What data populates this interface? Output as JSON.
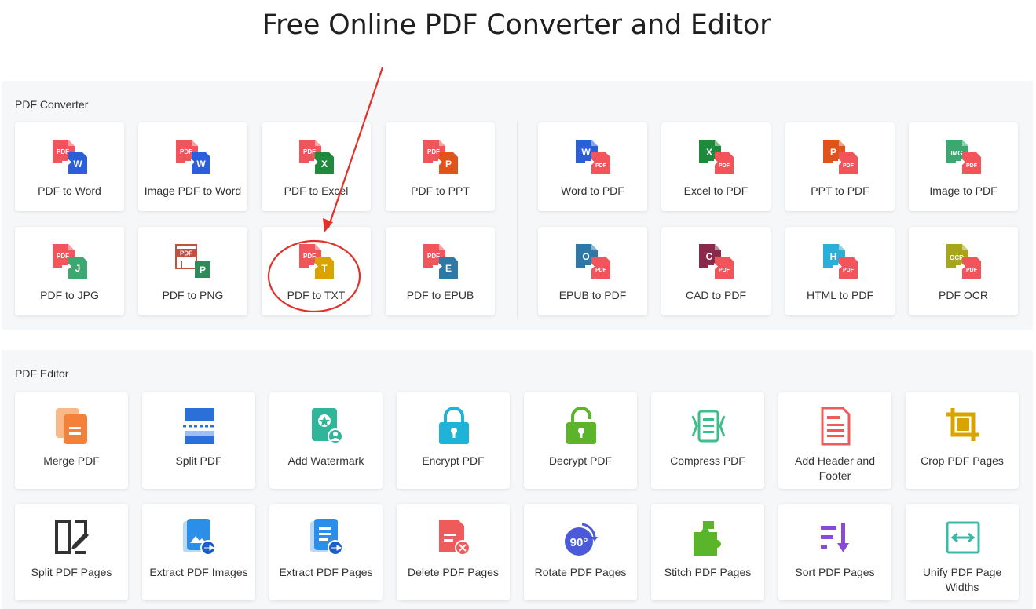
{
  "page": {
    "title": "Free Online PDF Converter and Editor"
  },
  "converter": {
    "title": "PDF Converter",
    "items": [
      {
        "label": "PDF to Word",
        "icon": "pdf-to-word-icon",
        "badge": "W",
        "color": "#2b5fd9"
      },
      {
        "label": "Image PDF to Word",
        "icon": "image-pdf-to-word-icon",
        "badge": "W",
        "color": "#2b5fd9"
      },
      {
        "label": "PDF to Excel",
        "icon": "pdf-to-excel-icon",
        "badge": "X",
        "color": "#1e8a3c"
      },
      {
        "label": "PDF to PPT",
        "icon": "pdf-to-ppt-icon",
        "badge": "P",
        "color": "#e0541c"
      },
      {
        "label": "Word to PDF",
        "icon": "word-to-pdf-icon",
        "badge": "W",
        "color": "#2b5fd9"
      },
      {
        "label": "Excel to PDF",
        "icon": "excel-to-pdf-icon",
        "badge": "X",
        "color": "#1e8a3c"
      },
      {
        "label": "PPT to PDF",
        "icon": "ppt-to-pdf-icon",
        "badge": "P",
        "color": "#e0541c"
      },
      {
        "label": "Image to PDF",
        "icon": "image-to-pdf-icon",
        "badge": "IMG",
        "color": "#3aa870"
      },
      {
        "label": "PDF to JPG",
        "icon": "pdf-to-jpg-icon",
        "badge": "J",
        "color": "#3aa870"
      },
      {
        "label": "PDF to PNG",
        "icon": "pdf-to-png-icon",
        "badge": "P",
        "color": "#2f8a5a"
      },
      {
        "label": "PDF to TXT",
        "icon": "pdf-to-txt-icon",
        "badge": "T",
        "color": "#d9a400"
      },
      {
        "label": "PDF to EPUB",
        "icon": "pdf-to-epub-icon",
        "badge": "E",
        "color": "#2e78a8"
      },
      {
        "label": "EPUB to PDF",
        "icon": "epub-to-pdf-icon",
        "badge": "O",
        "color": "#2e78a8"
      },
      {
        "label": "CAD to PDF",
        "icon": "cad-to-pdf-icon",
        "badge": "C",
        "color": "#8a2a4a"
      },
      {
        "label": "HTML to PDF",
        "icon": "html-to-pdf-icon",
        "badge": "H",
        "color": "#2ab0d8"
      },
      {
        "label": "PDF OCR",
        "icon": "pdf-ocr-icon",
        "badge": "OCR",
        "color": "#a7a51a"
      }
    ],
    "pdf_badge": "PDF",
    "pdf_color": "#f2545b"
  },
  "editor": {
    "title": "PDF Editor",
    "items": [
      {
        "label": "Merge PDF",
        "icon": "merge-pdf-icon",
        "color": "#f4813a"
      },
      {
        "label": "Split PDF",
        "icon": "split-pdf-icon",
        "color": "#2b6fd8"
      },
      {
        "label": "Add Watermark",
        "icon": "watermark-icon",
        "color": "#2fb59a"
      },
      {
        "label": "Encrypt PDF",
        "icon": "lock-icon",
        "color": "#1fb3d8"
      },
      {
        "label": "Decrypt PDF",
        "icon": "unlock-icon",
        "color": "#5ab52a"
      },
      {
        "label": "Compress PDF",
        "icon": "compress-icon",
        "color": "#3cbf8a"
      },
      {
        "label": "Add Header and Footer",
        "icon": "header-footer-icon",
        "color": "#ef5a5a"
      },
      {
        "label": "Crop PDF Pages",
        "icon": "crop-icon",
        "color": "#d9a400"
      },
      {
        "label": "Split PDF Pages",
        "icon": "split-pages-icon",
        "color": "#333333"
      },
      {
        "label": "Extract PDF Images",
        "icon": "extract-images-icon",
        "color": "#2b8ee8"
      },
      {
        "label": "Extract PDF Pages",
        "icon": "extract-pages-icon",
        "color": "#2b8ee8"
      },
      {
        "label": "Delete PDF Pages",
        "icon": "delete-pages-icon",
        "color": "#ef5a5a"
      },
      {
        "label": "Rotate PDF Pages",
        "icon": "rotate-icon",
        "color": "#4a5ad8",
        "badge": "90°"
      },
      {
        "label": "Stitch PDF Pages",
        "icon": "puzzle-icon",
        "color": "#5ab52a"
      },
      {
        "label": "Sort PDF Pages",
        "icon": "sort-icon",
        "color": "#8a4ad8"
      },
      {
        "label": "Unify PDF Page Widths",
        "icon": "unify-widths-icon",
        "color": "#3cb8a8"
      }
    ]
  },
  "annotation": {
    "highlight_color": "#e0322a",
    "highlighted_item": "PDF to TXT"
  }
}
